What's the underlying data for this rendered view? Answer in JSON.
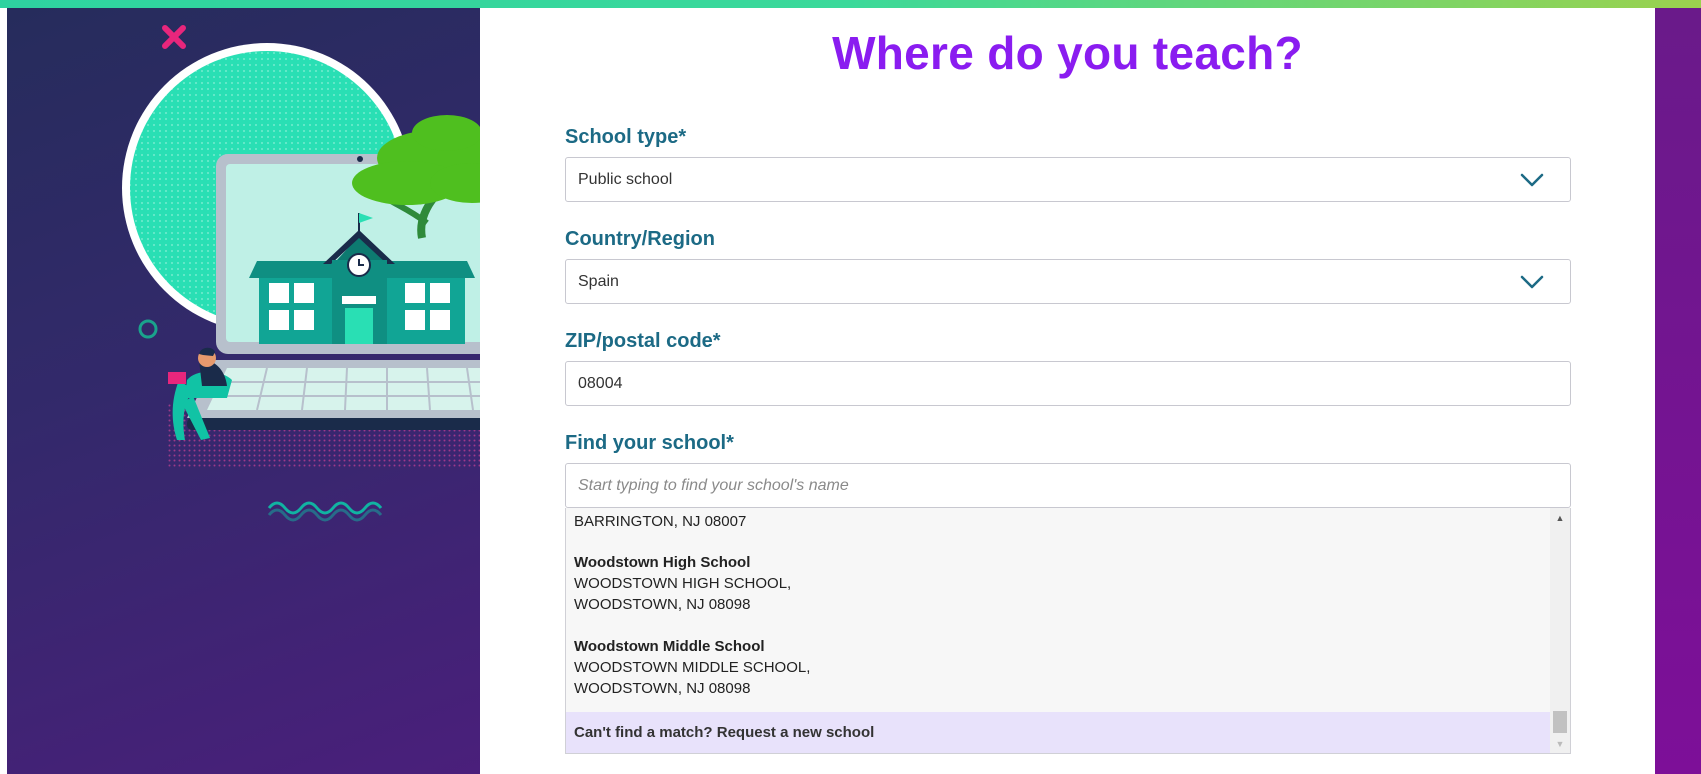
{
  "page": {
    "title": "Where do you teach?"
  },
  "form": {
    "school_type": {
      "label": "School type*",
      "value": "Public school"
    },
    "country": {
      "label": "Country/Region",
      "value": "Spain"
    },
    "zip": {
      "label": "ZIP/postal code*",
      "value": "08004"
    },
    "find_school": {
      "label": "Find your school*",
      "placeholder": "Start typing to find your school's name"
    }
  },
  "dropdown": {
    "partial_line": "BARRINGTON, NJ 08007",
    "results": [
      {
        "name": "Woodstown High School",
        "line1": "WOODSTOWN HIGH SCHOOL,",
        "line2": "WOODSTOWN, NJ 08098"
      },
      {
        "name": "Woodstown Middle School",
        "line1": "WOODSTOWN MIDDLE SCHOOL,",
        "line2": "WOODSTOWN, NJ 08098"
      }
    ],
    "request_label": "Can't find a match? Request a new school",
    "scroll_position": 1.0
  },
  "colors": {
    "title": "#8a1cf0",
    "label": "#1c6a85",
    "accent_bar": "#2ed3a0",
    "request_highlight": "#e8e2fb"
  },
  "icons": [
    "chevron-down-icon",
    "scroll-up-arrow-icon",
    "scroll-down-arrow-icon",
    "school-laptop-illustration"
  ]
}
